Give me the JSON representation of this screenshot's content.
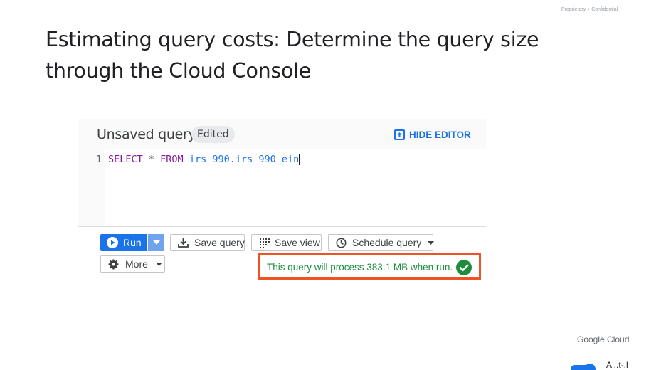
{
  "slide": {
    "confidential": "Proprietary + Confidential",
    "title_line1": "Estimating query costs: Determine the query size",
    "title_line2": "through the Cloud Console",
    "footer_logo": "Google Cloud",
    "corner_text": "A ..t-.l"
  },
  "query_editor": {
    "title": "Unsaved query",
    "badge": "Edited",
    "hide_editor_label": "HIDE EDITOR",
    "line_number": "1",
    "code": {
      "select_kw": "SELECT",
      "star": " * ",
      "from_kw": "FROM",
      "table": " irs_990.irs_990_ein"
    }
  },
  "toolbar": {
    "run_label": "Run",
    "save_query_label": "Save query",
    "save_view_label": "Save view",
    "schedule_query_label": "Schedule query",
    "more_label": "More"
  },
  "validator": {
    "message": "This query will process 383.1 MB when run.",
    "status": "valid",
    "status_color": "#1e8e3e"
  },
  "colors": {
    "accent": "#1a73e8",
    "highlight_border": "#ef5223",
    "keyword": "#8a1a9a"
  },
  "icons": [
    "open-in-new-icon",
    "play-icon",
    "chevron-down-icon",
    "download-icon",
    "grid-dots-icon",
    "clock-icon",
    "gear-icon",
    "check-circle-icon"
  ]
}
